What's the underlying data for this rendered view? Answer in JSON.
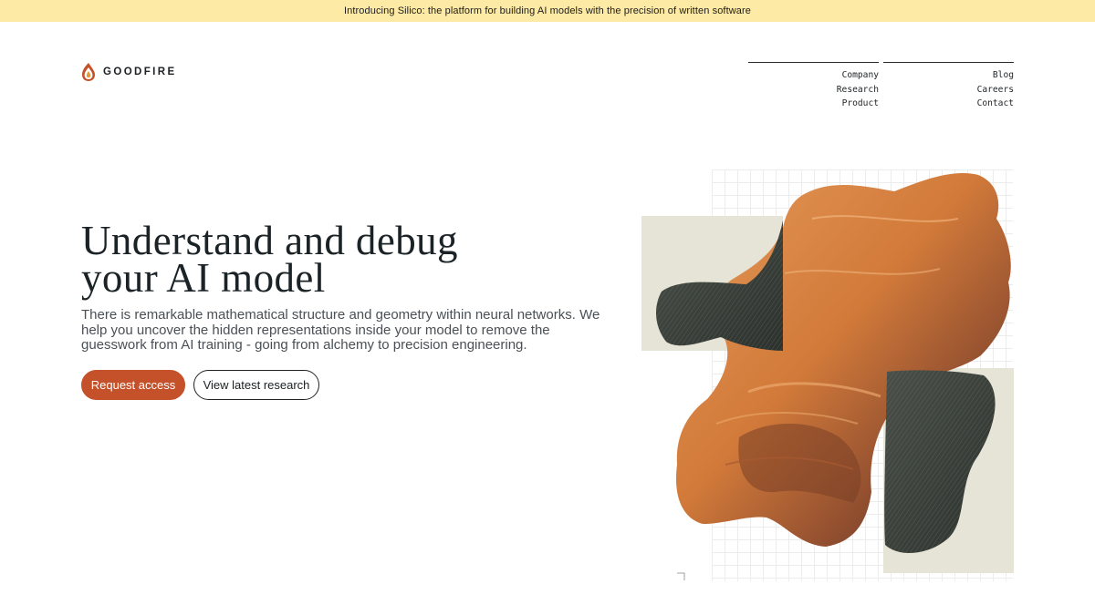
{
  "banner": {
    "text": "Introducing Silico: the platform for building AI models with the precision of written software"
  },
  "brand": {
    "logo_icon": "flame-logo-icon",
    "name": "GOODFIRE"
  },
  "nav": {
    "col1": [
      "Company",
      "Research",
      "Product"
    ],
    "col2": [
      "Blog",
      "Careers",
      "Contact"
    ]
  },
  "hero": {
    "headline_line1": "Understand and debug",
    "headline_line2": "your AI model",
    "subtext": "There is remarkable mathematical structure and geometry within neural networks. We help you uncover the hidden representations inside your model to remove the guesswork from AI training - going from alchemy to precision engineering.",
    "primary_cta": "Request access",
    "secondary_cta": "View latest research"
  },
  "colors": {
    "banner_bg": "#fdeaa4",
    "accent": "#c4512a",
    "text_dark": "#1b2327",
    "panel_beige": "#e6e4d6",
    "blob_orange": "#d8803f",
    "blob_dark": "#3a403a"
  }
}
